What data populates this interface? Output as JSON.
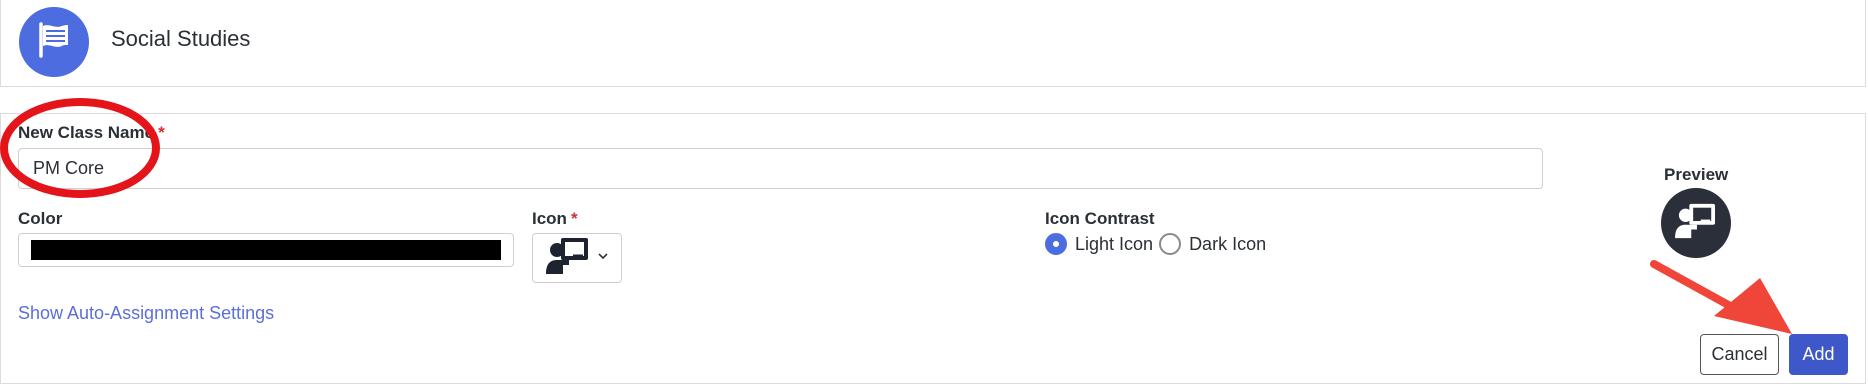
{
  "class_row": {
    "name": "Social Studies",
    "icon": "flag-icon",
    "avatar_color": "#4c6ce0"
  },
  "form": {
    "name_label": "New Class Name",
    "name_required": "*",
    "name_value": "PM Core",
    "color_label": "Color",
    "color_value": "#000000",
    "icon_label": "Icon",
    "icon_required": "*",
    "icon_selected": "teacher-board-icon",
    "contrast_label": "Icon Contrast",
    "contrast_options": [
      {
        "label": "Light Icon",
        "selected": true
      },
      {
        "label": "Dark Icon",
        "selected": false
      }
    ],
    "preview_label": "Preview",
    "preview_bg": "#2b2f3a",
    "auto_assign_link": "Show Auto-Assignment Settings"
  },
  "actions": {
    "cancel_label": "Cancel",
    "add_label": "Add",
    "accent": "#3e57c9"
  },
  "annotations": {
    "highlight_color": "#e3151a"
  }
}
